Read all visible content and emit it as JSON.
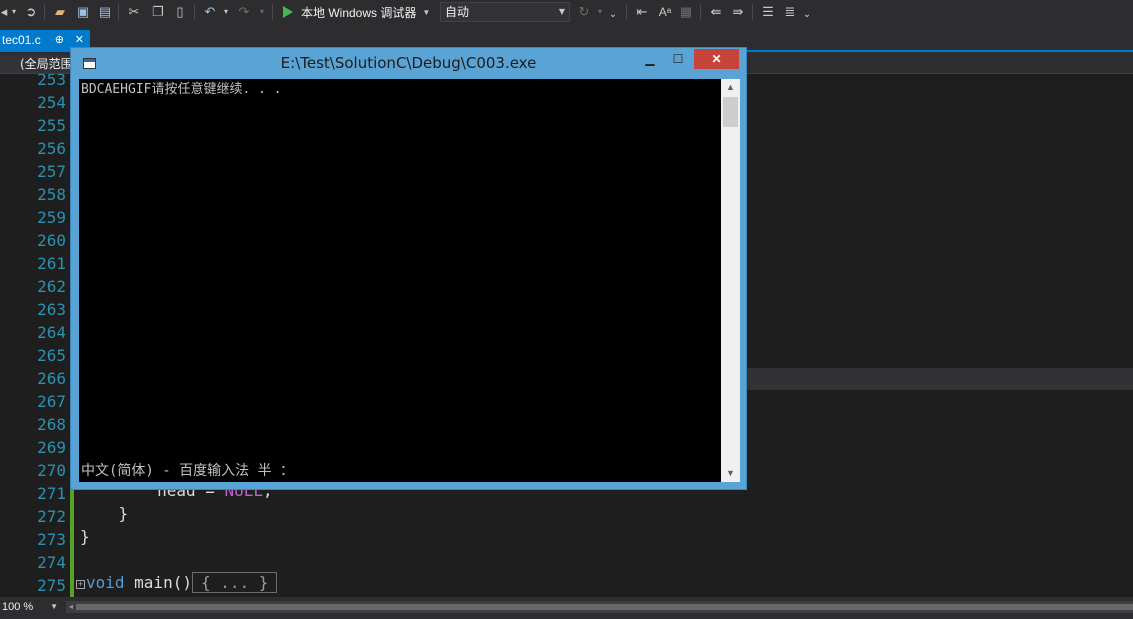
{
  "toolbar": {
    "run_label": "本地 Windows 调试器",
    "config_value": "自动"
  },
  "tab": {
    "filename": "tec01.c",
    "pin_glyph": "⊕",
    "close_glyph": "✕"
  },
  "scope": {
    "label": "(全局范围)"
  },
  "editor": {
    "line_numbers": [
      "253",
      "254",
      "255",
      "256",
      "257",
      "258",
      "259",
      "260",
      "261",
      "262",
      "263",
      "264",
      "265",
      "266",
      "267",
      "268",
      "269",
      "270",
      "271",
      "272",
      "273",
      "274",
      "275"
    ],
    "code": {
      "line271_left": "        head = ",
      "line271_null": "NULL",
      "line271_end": ";",
      "line272": "    }",
      "line273": "}",
      "line275_kw": "void",
      "line275_rest": " main()",
      "line275_collapsed": "{ ... }"
    }
  },
  "console": {
    "title": "E:\\Test\\SolutionC\\Debug\\C003.exe",
    "output": "BDCAEHGIF请按任意键继续. . .",
    "ime_status": "中文(简体) - 百度输入法 半 ："
  },
  "status": {
    "zoom": "100 %"
  },
  "icons": {
    "run": "play-icon",
    "save": "save-icon",
    "cut": "scissors-icon",
    "undo": "undo-icon",
    "redo": "redo-icon"
  }
}
